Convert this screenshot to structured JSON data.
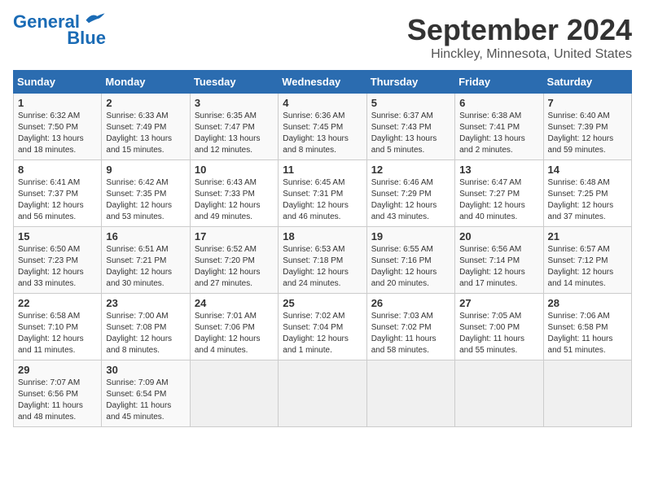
{
  "header": {
    "logo_line1": "General",
    "logo_line2": "Blue",
    "month": "September 2024",
    "location": "Hinckley, Minnesota, United States"
  },
  "weekdays": [
    "Sunday",
    "Monday",
    "Tuesday",
    "Wednesday",
    "Thursday",
    "Friday",
    "Saturday"
  ],
  "weeks": [
    [
      {
        "day": "1",
        "info": "Sunrise: 6:32 AM\nSunset: 7:50 PM\nDaylight: 13 hours\nand 18 minutes."
      },
      {
        "day": "2",
        "info": "Sunrise: 6:33 AM\nSunset: 7:49 PM\nDaylight: 13 hours\nand 15 minutes."
      },
      {
        "day": "3",
        "info": "Sunrise: 6:35 AM\nSunset: 7:47 PM\nDaylight: 13 hours\nand 12 minutes."
      },
      {
        "day": "4",
        "info": "Sunrise: 6:36 AM\nSunset: 7:45 PM\nDaylight: 13 hours\nand 8 minutes."
      },
      {
        "day": "5",
        "info": "Sunrise: 6:37 AM\nSunset: 7:43 PM\nDaylight: 13 hours\nand 5 minutes."
      },
      {
        "day": "6",
        "info": "Sunrise: 6:38 AM\nSunset: 7:41 PM\nDaylight: 13 hours\nand 2 minutes."
      },
      {
        "day": "7",
        "info": "Sunrise: 6:40 AM\nSunset: 7:39 PM\nDaylight: 12 hours\nand 59 minutes."
      }
    ],
    [
      {
        "day": "8",
        "info": "Sunrise: 6:41 AM\nSunset: 7:37 PM\nDaylight: 12 hours\nand 56 minutes."
      },
      {
        "day": "9",
        "info": "Sunrise: 6:42 AM\nSunset: 7:35 PM\nDaylight: 12 hours\nand 53 minutes."
      },
      {
        "day": "10",
        "info": "Sunrise: 6:43 AM\nSunset: 7:33 PM\nDaylight: 12 hours\nand 49 minutes."
      },
      {
        "day": "11",
        "info": "Sunrise: 6:45 AM\nSunset: 7:31 PM\nDaylight: 12 hours\nand 46 minutes."
      },
      {
        "day": "12",
        "info": "Sunrise: 6:46 AM\nSunset: 7:29 PM\nDaylight: 12 hours\nand 43 minutes."
      },
      {
        "day": "13",
        "info": "Sunrise: 6:47 AM\nSunset: 7:27 PM\nDaylight: 12 hours\nand 40 minutes."
      },
      {
        "day": "14",
        "info": "Sunrise: 6:48 AM\nSunset: 7:25 PM\nDaylight: 12 hours\nand 37 minutes."
      }
    ],
    [
      {
        "day": "15",
        "info": "Sunrise: 6:50 AM\nSunset: 7:23 PM\nDaylight: 12 hours\nand 33 minutes."
      },
      {
        "day": "16",
        "info": "Sunrise: 6:51 AM\nSunset: 7:21 PM\nDaylight: 12 hours\nand 30 minutes."
      },
      {
        "day": "17",
        "info": "Sunrise: 6:52 AM\nSunset: 7:20 PM\nDaylight: 12 hours\nand 27 minutes."
      },
      {
        "day": "18",
        "info": "Sunrise: 6:53 AM\nSunset: 7:18 PM\nDaylight: 12 hours\nand 24 minutes."
      },
      {
        "day": "19",
        "info": "Sunrise: 6:55 AM\nSunset: 7:16 PM\nDaylight: 12 hours\nand 20 minutes."
      },
      {
        "day": "20",
        "info": "Sunrise: 6:56 AM\nSunset: 7:14 PM\nDaylight: 12 hours\nand 17 minutes."
      },
      {
        "day": "21",
        "info": "Sunrise: 6:57 AM\nSunset: 7:12 PM\nDaylight: 12 hours\nand 14 minutes."
      }
    ],
    [
      {
        "day": "22",
        "info": "Sunrise: 6:58 AM\nSunset: 7:10 PM\nDaylight: 12 hours\nand 11 minutes."
      },
      {
        "day": "23",
        "info": "Sunrise: 7:00 AM\nSunset: 7:08 PM\nDaylight: 12 hours\nand 8 minutes."
      },
      {
        "day": "24",
        "info": "Sunrise: 7:01 AM\nSunset: 7:06 PM\nDaylight: 12 hours\nand 4 minutes."
      },
      {
        "day": "25",
        "info": "Sunrise: 7:02 AM\nSunset: 7:04 PM\nDaylight: 12 hours\nand 1 minute."
      },
      {
        "day": "26",
        "info": "Sunrise: 7:03 AM\nSunset: 7:02 PM\nDaylight: 11 hours\nand 58 minutes."
      },
      {
        "day": "27",
        "info": "Sunrise: 7:05 AM\nSunset: 7:00 PM\nDaylight: 11 hours\nand 55 minutes."
      },
      {
        "day": "28",
        "info": "Sunrise: 7:06 AM\nSunset: 6:58 PM\nDaylight: 11 hours\nand 51 minutes."
      }
    ],
    [
      {
        "day": "29",
        "info": "Sunrise: 7:07 AM\nSunset: 6:56 PM\nDaylight: 11 hours\nand 48 minutes."
      },
      {
        "day": "30",
        "info": "Sunrise: 7:09 AM\nSunset: 6:54 PM\nDaylight: 11 hours\nand 45 minutes."
      },
      {
        "day": "",
        "info": ""
      },
      {
        "day": "",
        "info": ""
      },
      {
        "day": "",
        "info": ""
      },
      {
        "day": "",
        "info": ""
      },
      {
        "day": "",
        "info": ""
      }
    ]
  ]
}
